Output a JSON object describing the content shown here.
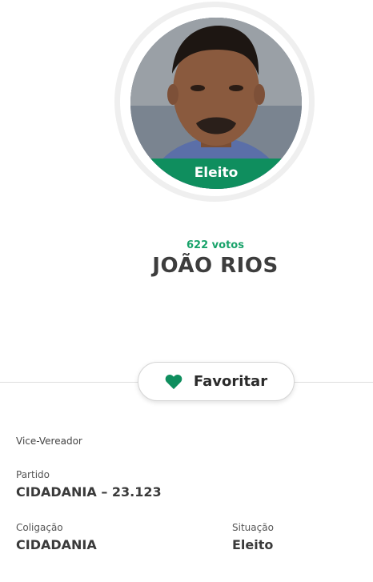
{
  "candidate": {
    "photo_alt": "JOÃO RIOS",
    "status_badge": "Eleito",
    "votes": "622 votos",
    "name": "JOÃO RIOS",
    "favorite_label": "Favoritar",
    "role": "Vice-Vereador"
  },
  "details": {
    "party_label": "Partido",
    "party_value": "CIDADANIA – 23.123",
    "coalition_label": "Coligação",
    "coalition_value": "CIDADANIA",
    "situation_label": "Situação",
    "situation_value": "Eleito"
  },
  "icons": {
    "favorite": "heart-icon"
  },
  "colors": {
    "accent": "#0f8e5e",
    "votes": "#1aa36b"
  }
}
